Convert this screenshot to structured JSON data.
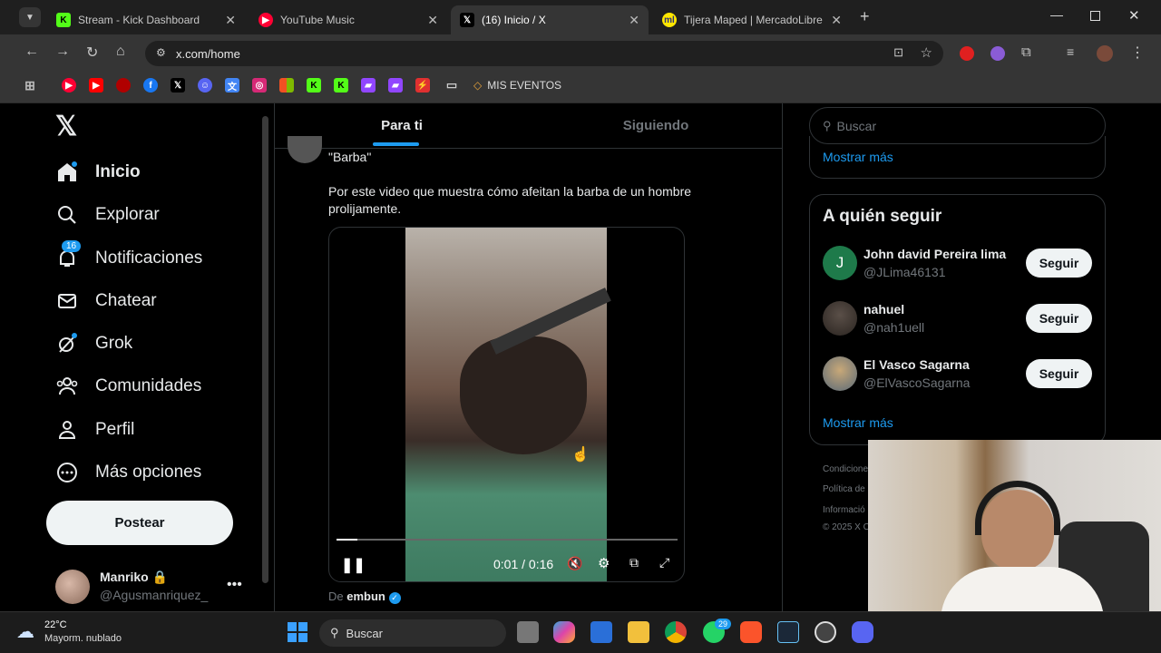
{
  "browser": {
    "tabs": [
      {
        "title": "Stream - Kick Dashboard"
      },
      {
        "title": "YouTube Music"
      },
      {
        "title": "(16) Inicio / X"
      },
      {
        "title": "Tijera Maped | MercadoLibre"
      }
    ],
    "url": "x.com/home",
    "bookmark_folder": "MIS EVENTOS"
  },
  "x": {
    "nav": [
      {
        "label": "Inicio",
        "icon": "home-icon"
      },
      {
        "label": "Explorar",
        "icon": "search-icon"
      },
      {
        "label": "Notificaciones",
        "icon": "bell-icon"
      },
      {
        "label": "Chatear",
        "icon": "mail-icon"
      },
      {
        "label": "Grok",
        "icon": "grok-icon"
      },
      {
        "label": "Comunidades",
        "icon": "people-icon"
      },
      {
        "label": "Perfil",
        "icon": "person-icon"
      },
      {
        "label": "Más opciones",
        "icon": "more-circle-icon"
      }
    ],
    "notif_count": "16",
    "post_label": "Postear",
    "account": {
      "name": "Manriko 🔒",
      "handle": "@Agusmanriquez_"
    },
    "tabs": {
      "for_you": "Para ti",
      "following": "Siguiendo"
    },
    "tweet": {
      "quote": "\"Barba\"",
      "text": "Por este video que muestra cómo afeitan la barba de un hombre prolijamente.",
      "time": "0:01 / 0:16",
      "from_label": "De",
      "from_user": "embun"
    },
    "search_placeholder": "Buscar",
    "show_more": "Mostrar más",
    "who_to_follow": {
      "title": "A quién seguir",
      "users": [
        {
          "name": "John david Pereira lima",
          "handle": "@JLima46131",
          "initial": "J"
        },
        {
          "name": "nahuel",
          "handle": "@nah1uell"
        },
        {
          "name": "El Vasco Sagarna",
          "handle": "@ElVascoSagarna"
        }
      ],
      "follow_label": "Seguir",
      "show_more": "Mostrar más"
    },
    "footer": [
      "Condicione",
      "Política de",
      "Informació",
      "© 2025 X C"
    ]
  },
  "taskbar": {
    "weather_temp": "22°C",
    "weather_desc": "Mayorm. nublado",
    "search": "Buscar",
    "whatsapp_badge": "29"
  }
}
